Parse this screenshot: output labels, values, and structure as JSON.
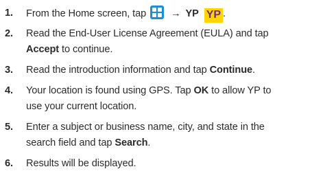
{
  "steps": [
    {
      "number": "1.",
      "text_before": "From the Home screen, tap",
      "apps_icon": "apps-grid-icon",
      "arrow": "→",
      "bold_label": "YP",
      "logo_text": "YP",
      "text_after": "."
    },
    {
      "number": "2.",
      "line1": "Read the End-User License Agreement (EULA) and tap",
      "bold": "Accept",
      "text_after": " to continue."
    },
    {
      "number": "3.",
      "text_before": "Read the introduction information and tap ",
      "bold": "Continue",
      "text_after": "."
    },
    {
      "number": "4.",
      "text_before": "Your location is found using GPS. Tap ",
      "bold": "OK",
      "line1_after": " to allow YP to",
      "line2": "use your current location."
    },
    {
      "number": "5.",
      "line1": "Enter a subject or business name, city, and state in the",
      "line2_before": "search field and tap ",
      "bold": "Search",
      "text_after": "."
    },
    {
      "number": "6.",
      "text": "Results will be displayed."
    }
  ],
  "colors": {
    "text": "#2b2b2b",
    "apps_icon_bg": "#1e8fd6",
    "logo_bg": "#ffd400",
    "logo_text": "#6a2d8a"
  }
}
